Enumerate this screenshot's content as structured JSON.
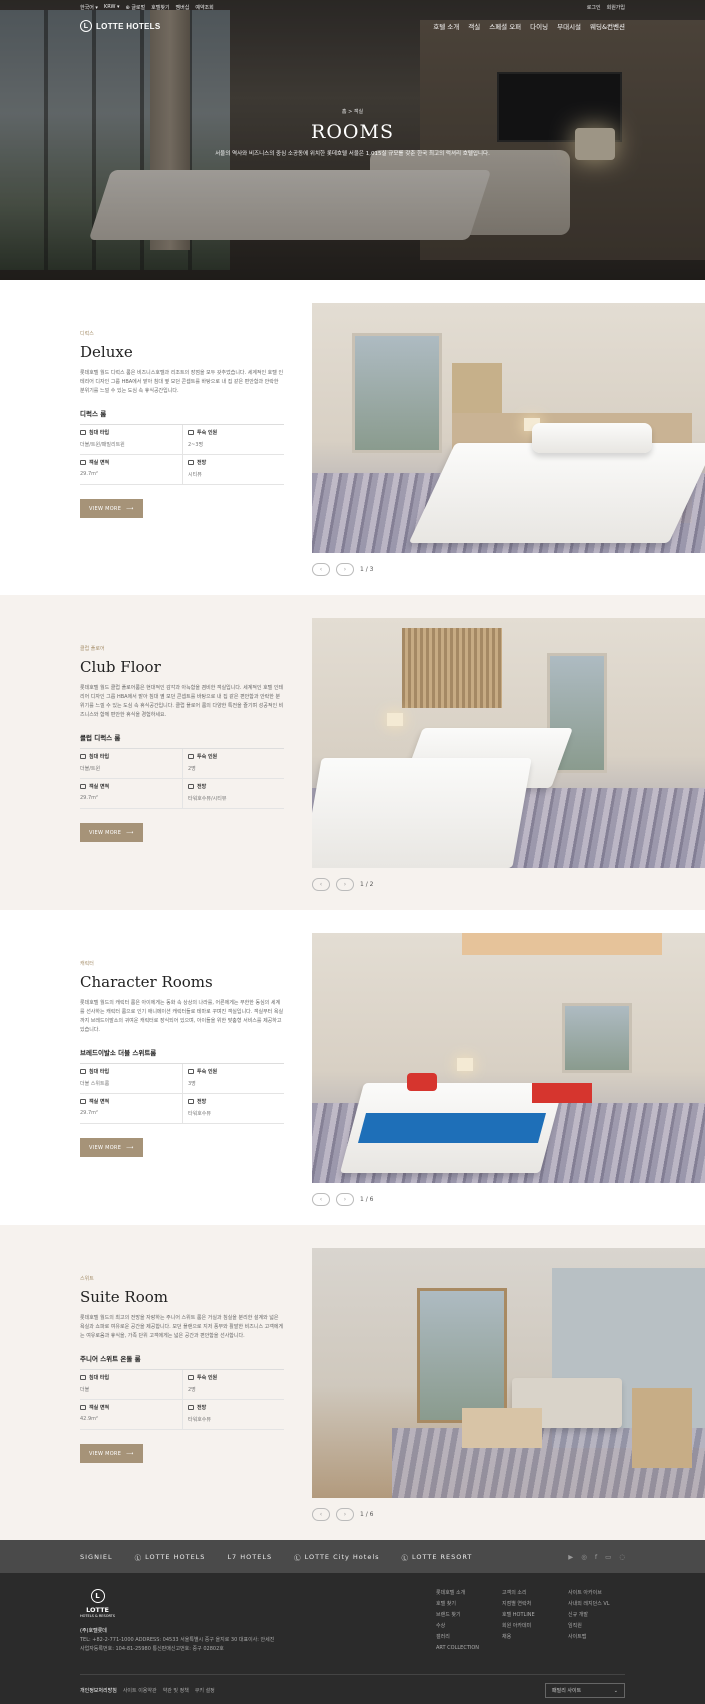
{
  "topbar": {
    "language": "한국어",
    "currency": "KRW",
    "links_left": [
      "글로벌",
      "호텔찾기",
      "멤버십",
      "예약조회"
    ],
    "links_right": [
      "로그인",
      "회원가입"
    ]
  },
  "nav": {
    "logo": "LOTTE HOTELS",
    "menu": [
      "호텔 소개",
      "객실",
      "스페셜 오퍼",
      "다이닝",
      "부대시설",
      "웨딩&컨벤션"
    ]
  },
  "hero": {
    "breadcrumb": [
      "홈",
      "객실"
    ],
    "title": "ROOMS",
    "subtitle": "서울의 역사와 비즈니스의 중심 소공동에 위치한 롯데호텔 서울은 1,015실 규모를 갖춘 한국 최고의 럭셔리 호텔입니다."
  },
  "rooms": [
    {
      "category": "디럭스",
      "title": "Deluxe",
      "description": "롯데호텔 월드 디럭스 룸은 비즈니스호텔과 리조트의 장점을 모두 갖추었습니다. 세계적인 호텔 인테리어 디자인 그룹 HBA에서 맡아 침대 옆 모던 콘셉트를 바탕으로 내 집 같은 편안함과 안락한 분위기를 느낄 수 있는 도심 속 휴식공간입니다.",
      "sub_title": "디럭스 룸",
      "specs": [
        {
          "icon": "bed-icon",
          "label": "침대 타입",
          "value": "더블/트윈/패밀리트윈"
        },
        {
          "icon": "people-icon",
          "label": "투숙 인원",
          "value": "2~3명"
        },
        {
          "icon": "area-icon",
          "label": "객실 면적",
          "value": "29.7m²"
        },
        {
          "icon": "view-icon",
          "label": "전망",
          "value": "시티뷰"
        }
      ],
      "button": "VIEW MORE",
      "pager": "1 / 3"
    },
    {
      "category": "클럽 플로어",
      "title": "Club Floor",
      "description": "롯데호텔 월드 클럽 플로어룸은 현대적인 감각과 아늑함을 겸비한 객실입니다. 세계적인 호텔 인테리어 디자인 그룹 HBA에서 맡아 침대 옆 모던 콘셉트를 바탕으로 내 집 같은 편안함과 안락한 분위기를 느낄 수 있는 도심 속 휴식공간입니다. 클럽 플로어 룸의 다양한 특전을 즐기며 성공적인 비즈니스와 함께 편안한 휴식을 경험하세요.",
      "sub_title": "클럽 디럭스 룸",
      "specs": [
        {
          "icon": "bed-icon",
          "label": "침대 타입",
          "value": "더블/트윈"
        },
        {
          "icon": "people-icon",
          "label": "투숙 인원",
          "value": "2명"
        },
        {
          "icon": "area-icon",
          "label": "객실 면적",
          "value": "29.7m²"
        },
        {
          "icon": "view-icon",
          "label": "전망",
          "value": "타워호수뷰/시티뷰"
        }
      ],
      "button": "VIEW MORE",
      "pager": "1 / 2"
    },
    {
      "category": "캐릭터",
      "title": "Character Rooms",
      "description": "롯데호텔 월드의 캐릭터 룸은 아이에게는 동화 속 상상의 나라를, 어른에게는 무한한 동심의 세계를 선사하는 캐릭터 룸으로 인기 애니메이션 캐릭터들로 테마로 꾸며진 객실입니다. 객실부터 욕실까지 브레드이발소의 귀여운 캐릭터로 장식되어 있으며, 아이들을 위한 맞춤형 서비스를 제공하고 있습니다.",
      "sub_title": "브레드이발소 더블 스위트룸",
      "specs": [
        {
          "icon": "bed-icon",
          "label": "침대 타입",
          "value": "더블 스위트룸"
        },
        {
          "icon": "people-icon",
          "label": "투숙 인원",
          "value": "3명"
        },
        {
          "icon": "area-icon",
          "label": "객실 면적",
          "value": "29.7m²"
        },
        {
          "icon": "view-icon",
          "label": "전망",
          "value": "타워호수뷰"
        }
      ],
      "button": "VIEW MORE",
      "pager": "1 / 6"
    },
    {
      "category": "스위트",
      "title": "Suite Room",
      "description": "롯데호텔 월드의 최고의 전망을 자랑하는 주니어 스위트 룸은 거실과 침실을 분리한 설계와 넓은 욕실과 쇼파로 여유로운 공간을 제공합니다. 모던 플랜으로 지저 풍부와 활발한 비즈니스 고객에게는 여유로움과 휴식을, 가족 단위 고객에게는 넓은 공간과 편안함을 선사합니다.",
      "sub_title": "주니어 스위트 온돌 룸",
      "specs": [
        {
          "icon": "bed-icon",
          "label": "침대 타입",
          "value": "더블"
        },
        {
          "icon": "people-icon",
          "label": "투숙 인원",
          "value": "2명"
        },
        {
          "icon": "area-icon",
          "label": "객실 면적",
          "value": "42.9m²"
        },
        {
          "icon": "view-icon",
          "label": "전망",
          "value": "타워호수뷰"
        }
      ],
      "button": "VIEW MORE",
      "pager": "1 / 6"
    }
  ],
  "brands": [
    "SIGNIEL",
    "LOTTE HOTELS",
    "L7 HOTELS",
    "LOTTE City Hotels",
    "LOTTE RESORT"
  ],
  "social": [
    "youtube-icon",
    "instagram-icon",
    "facebook-icon",
    "blog-icon",
    "chat-icon"
  ],
  "footer": {
    "logo": "LOTTE",
    "logo_sub": "HOTELS & RESORTS",
    "company": "(주)호텔롯데",
    "tel": "TEL: +82-2-771-1000   ADDRESS: 04533 서울특별시 중구 을지로 30   대표이사: 안세진",
    "biz": "사업자등록번호: 104-81-25980   통신판매신고번호: 중구 02802호",
    "columns": [
      [
        "롯데호텔 소개",
        "호텔 찾기",
        "브랜드 찾기",
        "수상",
        "갤러리",
        "ART COLLECTION"
      ],
      [
        "고객의 소리",
        "지점별 연락처",
        "호텔 HOTLINE",
        "회원 아카데미",
        "채용"
      ],
      [
        "사이트 아카이브",
        "사내외 레지던스 VL",
        "신규 개발",
        "임직원",
        "사이트맵"
      ]
    ],
    "bottom_links": [
      "개인정보처리방침",
      "사이트 이용약관",
      "약관 및 정책",
      "쿠키 설정"
    ],
    "family_site": "패밀리 사이트"
  }
}
